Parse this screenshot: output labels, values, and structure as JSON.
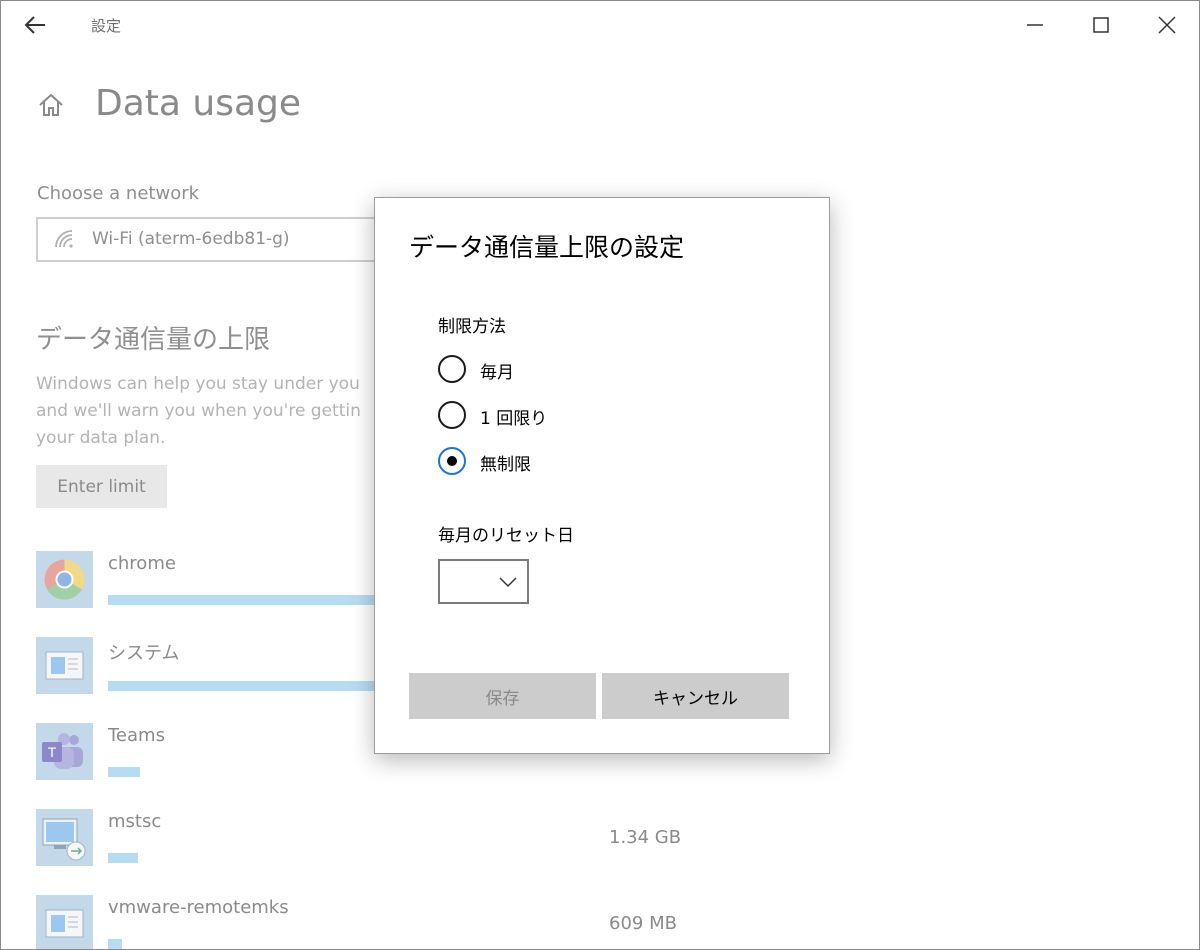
{
  "window": {
    "title": "設定"
  },
  "page": {
    "title": "Data usage",
    "choose_network_label": "Choose a network",
    "network_value": "Wi-Fi (aterm-6edb81-g)",
    "limit_heading": "データ通信量の上限",
    "limit_desc": "Windows can help you stay under you\nand we'll warn you when you're gettin\nyour data plan.",
    "enter_limit_label": "Enter limit",
    "apps": [
      {
        "name": "chrome",
        "usage": "",
        "icon": "chrome-icon",
        "bar_fraction": 1.0
      },
      {
        "name": "システム",
        "usage": "",
        "icon": "system-icon",
        "bar_fraction": 1.0
      },
      {
        "name": "Teams",
        "usage": "",
        "icon": "teams-icon",
        "bar_fraction": 0.12
      },
      {
        "name": "mstsc",
        "usage": "1.34 GB",
        "icon": "remote-desktop-icon",
        "bar_fraction": 0.11
      },
      {
        "name": "vmware-remotemks",
        "usage": "609 MB",
        "icon": "vmware-icon",
        "bar_fraction": 0.05
      }
    ]
  },
  "dialog": {
    "title": "データ通信量上限の設定",
    "method_label": "制限方法",
    "options": [
      {
        "label": "毎月",
        "selected": false
      },
      {
        "label": "1 回限り",
        "selected": false
      },
      {
        "label": "無制限",
        "selected": true
      }
    ],
    "reset_day_label": "毎月のリセット日",
    "reset_day_value": "",
    "save_label": "保存",
    "cancel_label": "キャンセル"
  },
  "colors": {
    "accent": "#1a73d8",
    "usage_bar": "#b6dcf3"
  }
}
